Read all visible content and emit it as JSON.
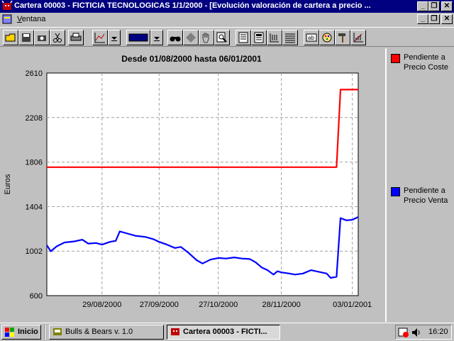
{
  "window": {
    "title": "Cartera 00003 - FICTICIA TECNOLOGICAS 1/1/2000 - [Evolución valoración de cartera a precio ...",
    "app_icon": "bull-icon"
  },
  "window_controls": {
    "minimize": "_",
    "restore": "❐",
    "close": "✕"
  },
  "menu": {
    "items": [
      {
        "label": "Ventana"
      }
    ]
  },
  "toolbar": {
    "icons": [
      "open-folder-icon",
      "save-icon",
      "camera-icon",
      "scissors-icon",
      "print-icon",
      "chart-type-icon",
      "dropdown-arrow-icon",
      "color-swatch-icon",
      "dropdown-arrow-icon",
      "binoculars-icon",
      "diamond-icon",
      "hand-icon",
      "zoom-icon",
      "document-icon",
      "table-icon",
      "columns-icon",
      "grid-icon",
      "text-ab-icon",
      "palette-icon",
      "hammer-icon",
      "axis-icon"
    ]
  },
  "colors": {
    "red_series": "#ff0000",
    "blue_series": "#0000ff",
    "titlebar": "#000080",
    "grid": "#a0a0a0"
  },
  "chart_data": {
    "type": "line",
    "title": "Desde 01/08/2000 hasta 06/01/2001",
    "ylabel": "Euros",
    "xlabel": "",
    "ylim": [
      600,
      2610
    ],
    "yticks": [
      600,
      1002,
      1404,
      1806,
      2208,
      2610
    ],
    "ytick_labels": [
      "600",
      "1002",
      "1404",
      "1806",
      "2208",
      "2610"
    ],
    "xlim": [
      "2000-08-01",
      "2001-01-06"
    ],
    "xticks": [
      "2000-08-29",
      "2000-09-27",
      "2000-10-27",
      "2000-11-28",
      "2001-01-03"
    ],
    "xtick_labels": [
      "29/08/2000",
      "27/09/2000",
      "27/10/2000",
      "28/11/2000",
      "03/01/2001"
    ],
    "grid": true,
    "legend_position": "right",
    "series": [
      {
        "name": "Pendiente a Precio Coste",
        "color": "#ff0000",
        "points": [
          [
            "2000-08-01",
            1760
          ],
          [
            "2000-12-26",
            1760
          ],
          [
            "2000-12-28",
            2460
          ],
          [
            "2001-01-06",
            2460
          ]
        ]
      },
      {
        "name": "Pendiente a Precio Venta",
        "color": "#0000ff",
        "points": [
          [
            "2000-08-01",
            1055
          ],
          [
            "2000-08-03",
            1000
          ],
          [
            "2000-08-06",
            1045
          ],
          [
            "2000-08-10",
            1080
          ],
          [
            "2000-08-15",
            1090
          ],
          [
            "2000-08-19",
            1105
          ],
          [
            "2000-08-22",
            1070
          ],
          [
            "2000-08-26",
            1075
          ],
          [
            "2000-08-29",
            1060
          ],
          [
            "2000-09-02",
            1085
          ],
          [
            "2000-09-05",
            1095
          ],
          [
            "2000-09-07",
            1180
          ],
          [
            "2000-09-11",
            1160
          ],
          [
            "2000-09-15",
            1140
          ],
          [
            "2000-09-20",
            1130
          ],
          [
            "2000-09-24",
            1110
          ],
          [
            "2000-09-27",
            1085
          ],
          [
            "2000-10-01",
            1060
          ],
          [
            "2000-10-05",
            1030
          ],
          [
            "2000-10-08",
            1040
          ],
          [
            "2000-10-12",
            985
          ],
          [
            "2000-10-16",
            920
          ],
          [
            "2000-10-19",
            890
          ],
          [
            "2000-10-23",
            925
          ],
          [
            "2000-10-27",
            940
          ],
          [
            "2000-10-31",
            935
          ],
          [
            "2000-11-04",
            945
          ],
          [
            "2000-11-08",
            935
          ],
          [
            "2000-11-12",
            930
          ],
          [
            "2000-11-15",
            900
          ],
          [
            "2000-11-18",
            855
          ],
          [
            "2000-11-21",
            830
          ],
          [
            "2000-11-24",
            790
          ],
          [
            "2000-11-26",
            820
          ],
          [
            "2000-11-28",
            810
          ],
          [
            "2000-12-02",
            800
          ],
          [
            "2000-12-05",
            790
          ],
          [
            "2000-12-09",
            800
          ],
          [
            "2000-12-13",
            830
          ],
          [
            "2000-12-17",
            815
          ],
          [
            "2000-12-21",
            800
          ],
          [
            "2000-12-23",
            760
          ],
          [
            "2000-12-26",
            770
          ],
          [
            "2000-12-28",
            1300
          ],
          [
            "2000-12-31",
            1280
          ],
          [
            "2001-01-03",
            1285
          ],
          [
            "2001-01-06",
            1310
          ]
        ]
      }
    ]
  },
  "legend": {
    "items": [
      {
        "label": "Pendiente a Precio Coste",
        "color": "#ff0000"
      },
      {
        "label": "Pendiente a Precio Venta",
        "color": "#0000ff"
      }
    ]
  },
  "taskbar": {
    "start_label": "Inicio",
    "tasks": [
      {
        "label": "Bulls & Bears v. 1.0"
      },
      {
        "label": "Cartera 00003 - FICTI..."
      }
    ],
    "clock": "16:20"
  }
}
